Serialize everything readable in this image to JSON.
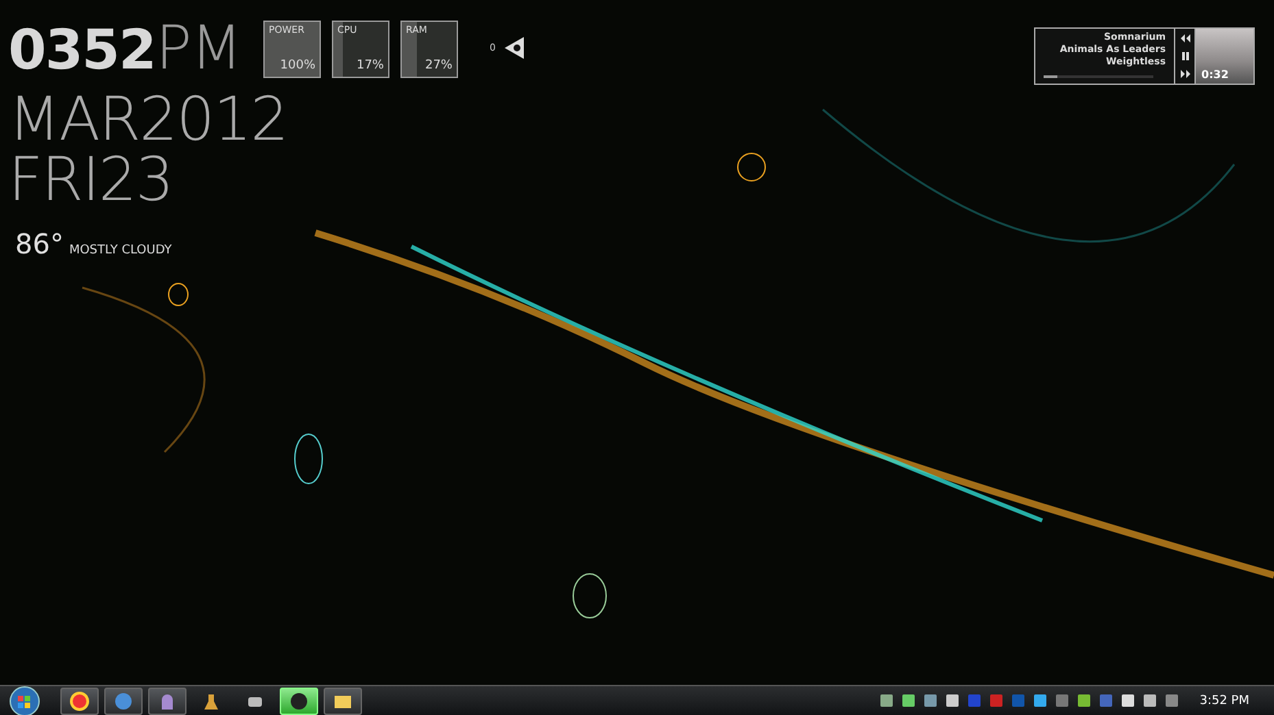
{
  "clock": {
    "time": "0352",
    "period": "PM",
    "month_year": "MAR2012",
    "day": "FRI23"
  },
  "weather": {
    "temperature": "86°",
    "condition": "MOSTLY CLOUDY"
  },
  "meters": [
    {
      "label": "POWER",
      "reading": "100%",
      "level": 1
    },
    {
      "label": "CPU",
      "reading": "17%",
      "level": 0.17
    },
    {
      "label": "RAM",
      "reading": "27%",
      "level": 0.27
    }
  ],
  "volume_widget": {
    "reading": "0"
  },
  "music_player": {
    "title": "Somnarium",
    "artist": "Animals As Leaders",
    "album": "Weightless",
    "elapsed": "0:32",
    "level": 0.12
  },
  "taskbar": {
    "apps": [
      {
        "kind": "browser",
        "running": true,
        "selected": false
      },
      {
        "kind": "music",
        "running": true,
        "selected": false
      },
      {
        "kind": "chat",
        "running": true,
        "selected": false
      },
      {
        "kind": "animal",
        "running": false,
        "selected": false
      },
      {
        "kind": "paint",
        "running": false,
        "selected": false
      },
      {
        "kind": "game",
        "running": true,
        "selected": true
      },
      {
        "kind": "folder",
        "running": true,
        "selected": false
      }
    ],
    "clock": "3:52 PM"
  }
}
